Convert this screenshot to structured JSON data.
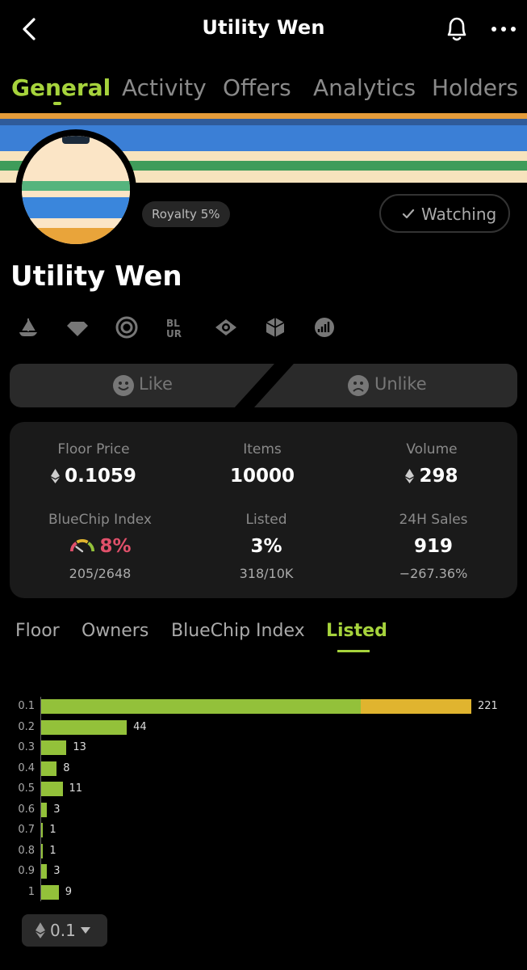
{
  "header": {
    "title": "Utility Wen"
  },
  "tabs": [
    "General",
    "Activity",
    "Offers",
    "Analytics",
    "Holders"
  ],
  "collection": {
    "name": "Utility Wen",
    "royalty": "Royalty 5%",
    "watch_label": "Watching"
  },
  "social_icons": [
    "opensea-icon",
    "diamond-icon",
    "target-icon",
    "blur-icon",
    "eye-icon",
    "cube-icon",
    "chart-icon"
  ],
  "reactions": {
    "like": "Like",
    "unlike": "Unlike"
  },
  "stats": {
    "floor_price": {
      "label": "Floor Price",
      "value": "0.1059"
    },
    "items": {
      "label": "Items",
      "value": "10000"
    },
    "volume": {
      "label": "Volume",
      "value": "298"
    },
    "bluechip": {
      "label": "BlueChip Index",
      "value": "8%",
      "sub": "205/2648"
    },
    "listed": {
      "label": "Listed",
      "value": "3%",
      "sub": "318/10K"
    },
    "sales": {
      "label": "24H Sales",
      "value": "919",
      "sub": "−267.36%"
    }
  },
  "subtabs": [
    "Floor",
    "Owners",
    "BlueChip Index",
    "Listed"
  ],
  "chart_data": {
    "type": "bar",
    "orientation": "horizontal",
    "categories": [
      "0.1",
      "0.2",
      "0.3",
      "0.4",
      "0.5",
      "0.6",
      "0.7",
      "0.8",
      "0.9",
      "1"
    ],
    "values": [
      221,
      44,
      13,
      8,
      11,
      3,
      1,
      1,
      3,
      9
    ],
    "first_bar_split": [
      164,
      57
    ],
    "colors": {
      "primary": "#93c13a",
      "secondary": "#e0b42f"
    },
    "xlim": [
      0,
      221
    ]
  },
  "unit_button": "0.1",
  "colors": {
    "accent": "#a6d33c",
    "danger": "#e0506a"
  }
}
